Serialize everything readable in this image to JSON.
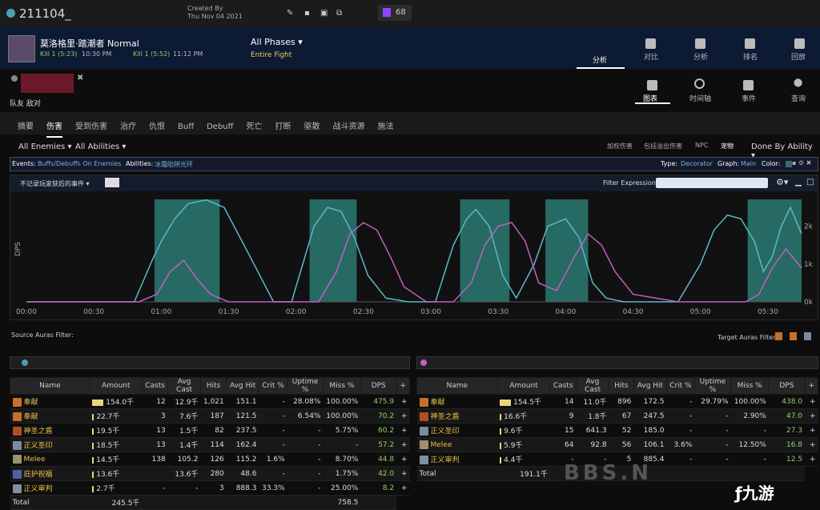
{
  "top": {
    "report_id": "211104_",
    "created_label": "Created By",
    "created_date": "Thu Nov 04 2021",
    "twitch_count": "68"
  },
  "header": {
    "boss_name": "莫洛格里·踏潮者 Normal",
    "kill1": "Kill 1 (5:23)",
    "kill1_time": "10:30 PM",
    "kill2": "Kill 1 (5:52)",
    "kill2_time": "11:12 PM",
    "phases": "All Phases",
    "fight": "Entire Fight",
    "tabs": [
      {
        "label": "分析",
        "active": true
      },
      {
        "label": "对比"
      },
      {
        "label": "分析"
      },
      {
        "label": "排名"
      },
      {
        "label": "回放"
      }
    ]
  },
  "views": [
    {
      "label": "图表",
      "active": true
    },
    {
      "label": "时间轴"
    },
    {
      "label": "事件"
    },
    {
      "label": "查询"
    }
  ],
  "team_label": "队友 敌对",
  "nav_tabs": [
    "摘要",
    "伤害",
    "受到伤害",
    "治疗",
    "仇恨",
    "Buff",
    "Debuff",
    "死亡",
    "打断",
    "驱散",
    "战斗资源",
    "施法"
  ],
  "active_tab": "伤害",
  "filters": {
    "enemies": "All Enemies",
    "abilities": "All Abilities",
    "opt1": "加权伤害",
    "opt2": "包括溢出伤害",
    "opt3": "NPC",
    "opt4": "宠物",
    "sort": "Done By Ability"
  },
  "events_bar": {
    "events_label": "Events:",
    "events_value": "Buffs/Debuffs On Enemies",
    "abilities_label": "Abilities:",
    "abilities_value": "冰霜陷阱光环",
    "type_label": "Type:",
    "type_value": "Decorator",
    "graph_label": "Graph:",
    "graph_value": "Main",
    "color_label": "Color:"
  },
  "chart_toolbar": {
    "dropdown": "不记录玩家获后的事件",
    "filter_label": "Filter Expression:"
  },
  "chart_data": {
    "type": "line",
    "x_ticks": [
      "00:00",
      "00:30",
      "01:00",
      "01:30",
      "02:00",
      "02:30",
      "03:00",
      "03:30",
      "04:00",
      "04:30",
      "05:00",
      "05:30"
    ],
    "y_ticks": [
      "2k",
      "1k",
      "0k"
    ],
    "ylabel": "DPS",
    "xlim": [
      0,
      345
    ],
    "ylim": [
      0,
      2800
    ],
    "bands": [
      [
        57,
        86
      ],
      [
        126,
        147
      ],
      [
        193,
        215
      ],
      [
        231,
        250
      ],
      [
        321,
        345
      ]
    ],
    "series": [
      {
        "color": "#5cb8c8",
        "x": [
          0,
          30,
          48,
          56,
          60,
          66,
          72,
          80,
          88,
          96,
          110,
          118,
          124,
          128,
          134,
          140,
          146,
          152,
          160,
          170,
          182,
          190,
          196,
          200,
          206,
          212,
          218,
          226,
          232,
          240,
          246,
          252,
          258,
          266,
          272,
          280,
          290,
          300,
          306,
          312,
          318,
          324,
          328,
          332,
          336,
          340,
          345
        ],
        "y": [
          0,
          0,
          0,
          1100,
          1600,
          2200,
          2600,
          2700,
          2500,
          1600,
          0,
          0,
          1200,
          2000,
          2500,
          2400,
          1700,
          700,
          100,
          0,
          0,
          1500,
          2200,
          2450,
          2000,
          700,
          100,
          1000,
          2000,
          2200,
          1700,
          500,
          100,
          0,
          0,
          0,
          0,
          1000,
          1900,
          2300,
          2200,
          1600,
          800,
          1200,
          2000,
          2500,
          1800
        ]
      },
      {
        "color": "#c060c0",
        "x": [
          0,
          50,
          58,
          64,
          70,
          76,
          82,
          90,
          100,
          110,
          130,
          138,
          144,
          150,
          156,
          162,
          168,
          178,
          190,
          198,
          204,
          210,
          216,
          222,
          228,
          236,
          244,
          250,
          256,
          262,
          270,
          290,
          310,
          320,
          326,
          332,
          338,
          345
        ],
        "y": [
          0,
          0,
          200,
          800,
          1100,
          600,
          200,
          0,
          0,
          0,
          0,
          800,
          1800,
          2100,
          1900,
          1200,
          400,
          0,
          0,
          500,
          1500,
          2000,
          2100,
          1600,
          500,
          300,
          1200,
          1800,
          1500,
          800,
          200,
          0,
          0,
          0,
          200,
          900,
          1400,
          900
        ]
      }
    ]
  },
  "labels": {
    "source_filter": "Source Auras Filter:",
    "target_filter": "Target Auras Filter:"
  },
  "columns": [
    "Name",
    "Amount",
    "Casts",
    "Avg Cast",
    "Hits",
    "Avg Hit",
    "Crit %",
    "Uptime %",
    "Miss %",
    "DPS",
    "+"
  ],
  "left_rows": [
    {
      "name": "奉献",
      "amount": "154.0千",
      "bar": 1.0,
      "casts": "12",
      "avgcast": "12.9千",
      "hits": "1,021",
      "avghit": "151.1",
      "crit": "-",
      "uptime": "28.08%",
      "miss": "100.00%",
      "dps": "475.9",
      "icon": "#c8702a"
    },
    {
      "name": "奉献",
      "amount": "22.7千",
      "bar": 0.15,
      "casts": "3",
      "avgcast": "7.6千",
      "hits": "187",
      "avghit": "121.5",
      "crit": "-",
      "uptime": "6.54%",
      "miss": "100.00%",
      "dps": "70.2",
      "icon": "#c8702a"
    },
    {
      "name": "神圣之盾",
      "amount": "19.5千",
      "bar": 0.12,
      "casts": "13",
      "avgcast": "1.5千",
      "hits": "82",
      "avghit": "237.5",
      "crit": "-",
      "uptime": "-",
      "miss": "5.75%",
      "dps": "60.2",
      "icon": "#b05020"
    },
    {
      "name": "正义圣印",
      "amount": "18.5千",
      "bar": 0.12,
      "casts": "13",
      "avgcast": "1.4千",
      "hits": "114",
      "avghit": "162.4",
      "crit": "-",
      "uptime": "-",
      "miss": "-",
      "dps": "57.2",
      "icon": "#7a8aa0"
    },
    {
      "name": "Melee",
      "amount": "14.5千",
      "bar": 0.09,
      "casts": "138",
      "avgcast": "105.2",
      "hits": "126",
      "avghit": "115.2",
      "crit": "1.6%",
      "uptime": "-",
      "miss": "8.70%",
      "dps": "44.8",
      "icon": "#a09070"
    },
    {
      "name": "庇护祝福",
      "amount": "13.6千",
      "bar": 0.09,
      "casts": "",
      "avgcast": "13.6千",
      "hits": "280",
      "avghit": "48.6",
      "crit": "-",
      "uptime": "-",
      "miss": "1.75%",
      "dps": "42.0",
      "icon": "#5060a0"
    },
    {
      "name": "正义审判",
      "amount": "2.7千",
      "bar": 0.02,
      "casts": "-",
      "avgcast": "-",
      "hits": "3",
      "avghit": "888.3",
      "crit": "33.3%",
      "uptime": "-",
      "miss": "25.00%",
      "dps": "8.2",
      "icon": "#8090a0"
    }
  ],
  "left_total": {
    "label": "Total",
    "amount": "245.5千",
    "dps": "758.5"
  },
  "right_rows": [
    {
      "name": "奉献",
      "amount": "154.5千",
      "bar": 1.0,
      "casts": "14",
      "avgcast": "11.0千",
      "hits": "896",
      "avghit": "172.5",
      "crit": "-",
      "uptime": "29.79%",
      "miss": "100.00%",
      "dps": "438.0",
      "icon": "#c8702a"
    },
    {
      "name": "神圣之盾",
      "amount": "16.6千",
      "bar": 0.11,
      "casts": "9",
      "avgcast": "1.8千",
      "hits": "67",
      "avghit": "247.5",
      "crit": "-",
      "uptime": "-",
      "miss": "2.90%",
      "dps": "47.0",
      "icon": "#b05020"
    },
    {
      "name": "正义圣印",
      "amount": "9.6千",
      "bar": 0.06,
      "casts": "15",
      "avgcast": "641.3",
      "hits": "52",
      "avghit": "185.0",
      "crit": "-",
      "uptime": "-",
      "miss": "-",
      "dps": "27.3",
      "icon": "#7a8aa0"
    },
    {
      "name": "Melee",
      "amount": "5.9千",
      "bar": 0.04,
      "casts": "64",
      "avgcast": "92.8",
      "hits": "56",
      "avghit": "106.1",
      "crit": "3.6%",
      "uptime": "-",
      "miss": "12.50%",
      "dps": "16.8",
      "icon": "#a09070"
    },
    {
      "name": "正义审判",
      "amount": "4.4千",
      "bar": 0.03,
      "casts": "-",
      "avgcast": "-",
      "hits": "5",
      "avghit": "885.4",
      "crit": "-",
      "uptime": "-",
      "miss": "-",
      "dps": "12.5",
      "icon": "#8090a0"
    }
  ],
  "right_total": {
    "label": "Total",
    "amount": "191.1千"
  },
  "watermark": {
    "text": "BBS.N",
    "logo": "九游"
  }
}
